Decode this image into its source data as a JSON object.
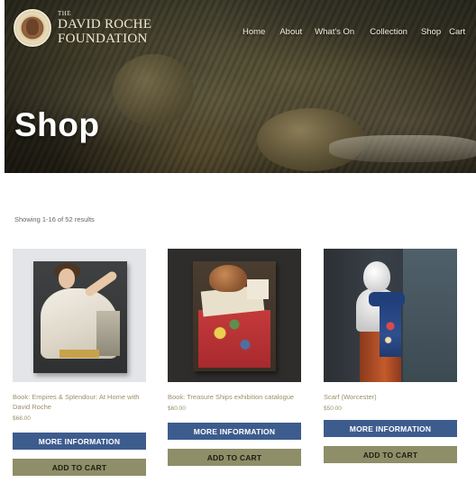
{
  "header": {
    "logo": {
      "the": "THE",
      "line1": "DAVID ROCHE",
      "line2": "FOUNDATION"
    },
    "nav": [
      {
        "label": "Home"
      },
      {
        "label": "About"
      },
      {
        "label": "What's On"
      },
      {
        "label": "Collection"
      },
      {
        "label": "Shop"
      },
      {
        "label": "Cart"
      }
    ],
    "page_title": "Shop"
  },
  "results": {
    "text": "Showing 1-16 of 52 results"
  },
  "products": [
    {
      "name": "Book: Empires & Splendour: At Home with David Roche",
      "price": "$68.00",
      "info_label": "MORE INFORMATION",
      "cart_label": "ADD TO CART"
    },
    {
      "name": "Book: Treasure Ships exhibition catalogue",
      "price": "$60.00",
      "info_label": "MORE INFORMATION",
      "cart_label": "ADD TO CART"
    },
    {
      "name": "Scarf (Worcester)",
      "price": "$50.00",
      "info_label": "MORE INFORMATION",
      "cart_label": "ADD TO CART"
    }
  ],
  "colors": {
    "button_info": "#3d5c8e",
    "button_cart": "#8e8e68",
    "product_text": "#9a8f6a"
  }
}
